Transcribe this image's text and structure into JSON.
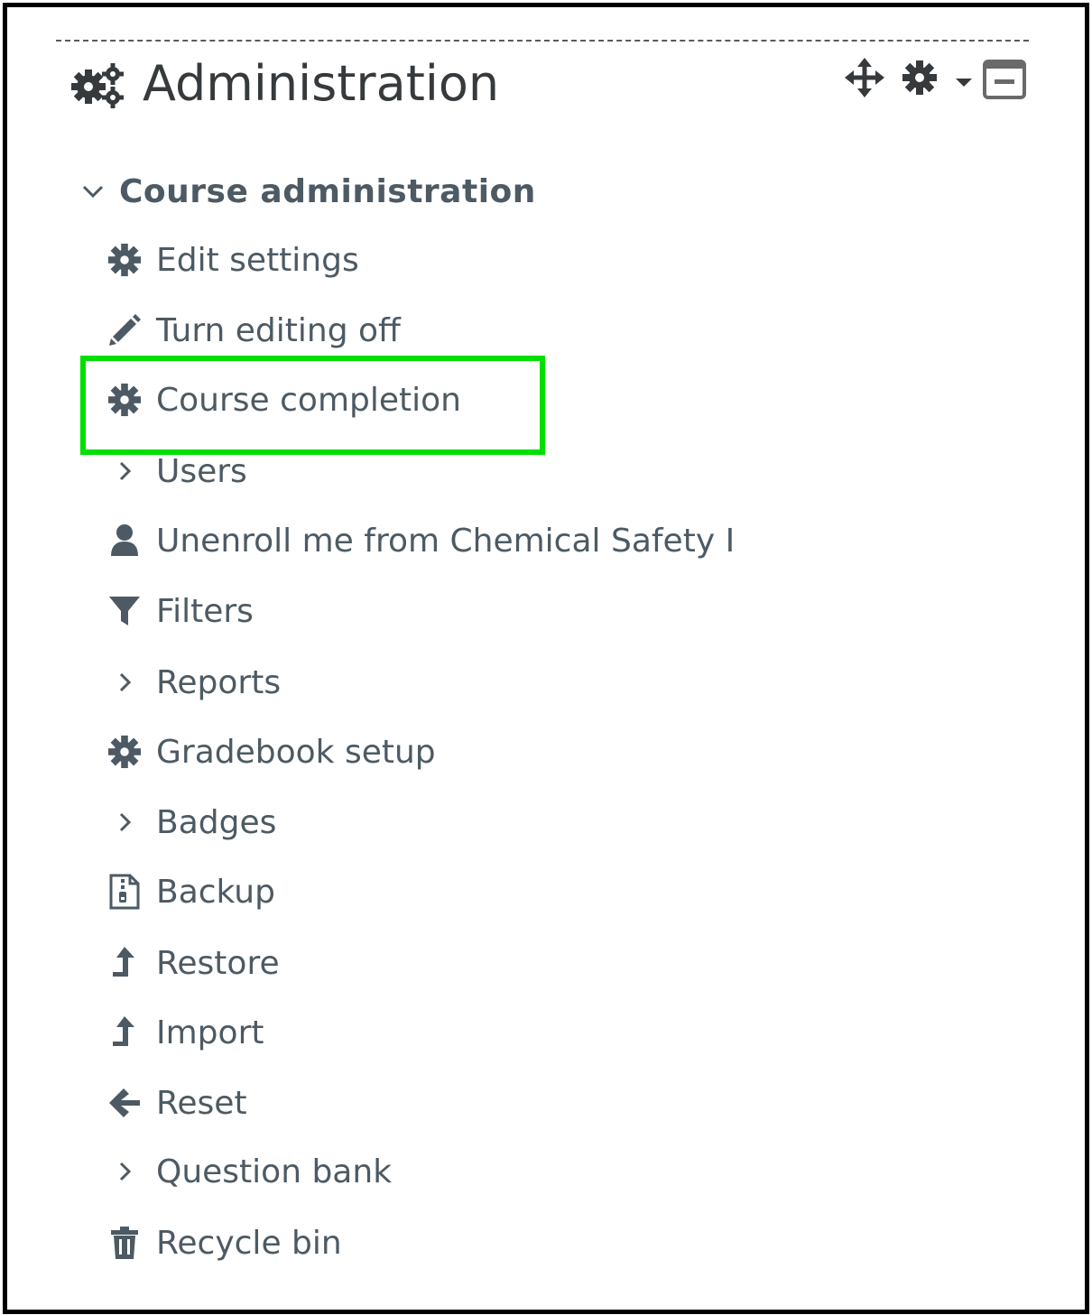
{
  "block": {
    "title": "Administration",
    "icons": {
      "title": "cogs-icon",
      "move": "move-arrows-icon",
      "actions": "gear-icon",
      "actions_menu": "caret-down-icon",
      "collapse": "minus-square-icon"
    }
  },
  "section": {
    "label": "Course administration",
    "icon": "chevron-down-icon"
  },
  "items": [
    {
      "label": "Edit settings",
      "icon": "gear-icon"
    },
    {
      "label": "Turn editing off",
      "icon": "pencil-icon"
    },
    {
      "label": "Course completion",
      "icon": "gear-icon"
    },
    {
      "label": "Users",
      "icon": "chevron-right-icon"
    },
    {
      "label": "Unenroll me from Chemical Safety I",
      "icon": "user-icon"
    },
    {
      "label": "Filters",
      "icon": "filter-icon"
    },
    {
      "label": "Reports",
      "icon": "chevron-right-icon"
    },
    {
      "label": "Gradebook setup",
      "icon": "gear-icon"
    },
    {
      "label": "Badges",
      "icon": "chevron-right-icon"
    },
    {
      "label": "Backup",
      "icon": "file-archive-icon"
    },
    {
      "label": "Restore",
      "icon": "upload-arrow-icon"
    },
    {
      "label": "Import",
      "icon": "upload-arrow-icon"
    },
    {
      "label": "Reset",
      "icon": "arrow-left-icon"
    },
    {
      "label": "Question bank",
      "icon": "chevron-right-icon"
    },
    {
      "label": "Recycle bin",
      "icon": "trash-icon"
    }
  ],
  "highlight": {
    "target": "Course completion",
    "color": "#00e000"
  },
  "colors": {
    "text": "#4d5a63",
    "title": "#373a3c",
    "border": "#000000"
  }
}
